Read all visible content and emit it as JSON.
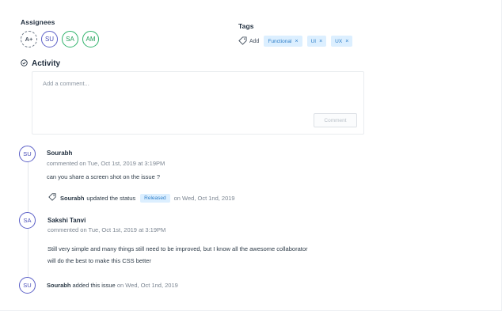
{
  "assignees": {
    "label": "Assignees",
    "add_label": "A+",
    "avatars": [
      "SU",
      "SA",
      "AM"
    ]
  },
  "tags": {
    "label": "Tags",
    "add_label": "Add",
    "items": [
      "Functional",
      "UI",
      "UX"
    ],
    "remove_glyph": "×"
  },
  "activity": {
    "title": "Activity",
    "placeholder": "Add a comment...",
    "comment_button": "Comment"
  },
  "timeline": {
    "comment1": {
      "initials": "SU",
      "author": "Sourabh",
      "meta": "commented on Tue, Oct 1st, 2019 at 3:19PM",
      "text": "can you share a screen shot on the issue ?"
    },
    "status_update": {
      "author": "Sourabh",
      "action": "updated the status",
      "status": "Released",
      "date": "on Wed, Oct 1nd, 2019"
    },
    "comment2": {
      "initials": "SA",
      "author": "Sakshi Tanvi",
      "meta": "commented on Tue, Oct 1st, 2019 at 3:19PM",
      "line1": "Still very simple and many things still need to be improved, but I know all the awesome collaborator",
      "line2": "will do the best to make this CSS better"
    },
    "added": {
      "initials": "SU",
      "author": "Sourabh",
      "action": "added this issue",
      "date": "on Wed, Oct 1nd, 2019"
    }
  },
  "colors": {
    "avatar_blue": "#5b5fc7",
    "avatar_green": "#2fb36b",
    "chip_bg": "#dcefff",
    "chip_text": "#2f7fc9"
  }
}
